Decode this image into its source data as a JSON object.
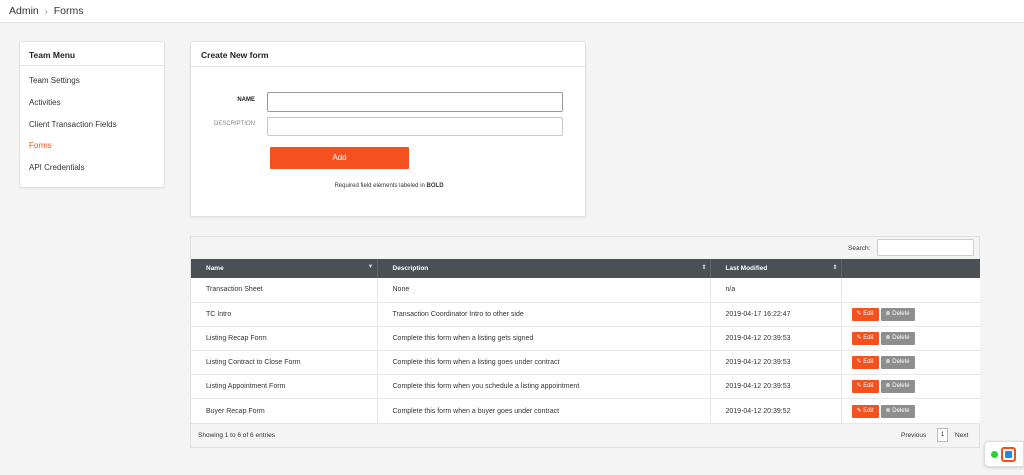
{
  "breadcrumb": {
    "root": "Admin",
    "separator": "›",
    "current": "Forms"
  },
  "team_menu": {
    "title": "Team Menu",
    "items": [
      "Team Settings",
      "Activities",
      "Client Transaction Fields",
      "Forms",
      "API Credentials"
    ],
    "active": "Forms"
  },
  "create_form": {
    "title": "Create New form",
    "name_label": "NAME",
    "name_value": "",
    "description_label": "DESCRIPTION",
    "description_value": "",
    "add_label": "Add",
    "required_note": "Required field elements labeled in",
    "required_bold": "BOLD"
  },
  "forms_table": {
    "search_label": "Search:",
    "search_value": "",
    "columns": [
      "Name",
      "Description",
      "Last Modified",
      ""
    ],
    "rows": [
      {
        "name": "Transaction Sheet",
        "description": "None",
        "modified": "n/a",
        "has_actions": false
      },
      {
        "name": "TC Intro",
        "description": "Transaction Coordinator Intro to other side",
        "modified": "2019-04-17 16:22:47",
        "has_actions": true
      },
      {
        "name": "Listing Recap Form",
        "description": "Complete this form when a listing gets signed",
        "modified": "2019-04-12 20:39:53",
        "has_actions": true
      },
      {
        "name": "Listing Contract to Close Form",
        "description": "Complete this form when a listing goes under contract",
        "modified": "2019-04-12 20:39:53",
        "has_actions": true
      },
      {
        "name": "Listing Appointment Form",
        "description": "Complete this form when you schedule a listing appointment",
        "modified": "2019-04-12 20:39:53",
        "has_actions": true
      },
      {
        "name": "Buyer Recap Form",
        "description": "Complete this form when a buyer goes under contract",
        "modified": "2019-04-12 20:39:52",
        "has_actions": true
      }
    ],
    "edit_label": "Edit",
    "delete_label": "Delete",
    "showing": "Showing 1 to 6 of 6 entries",
    "prev_label": "Previous",
    "page_label": "1",
    "next_label": "Next"
  },
  "colors": {
    "accent": "#f4511e",
    "header_bg": "#4a5056",
    "delete_bg": "#8e8e8e"
  }
}
